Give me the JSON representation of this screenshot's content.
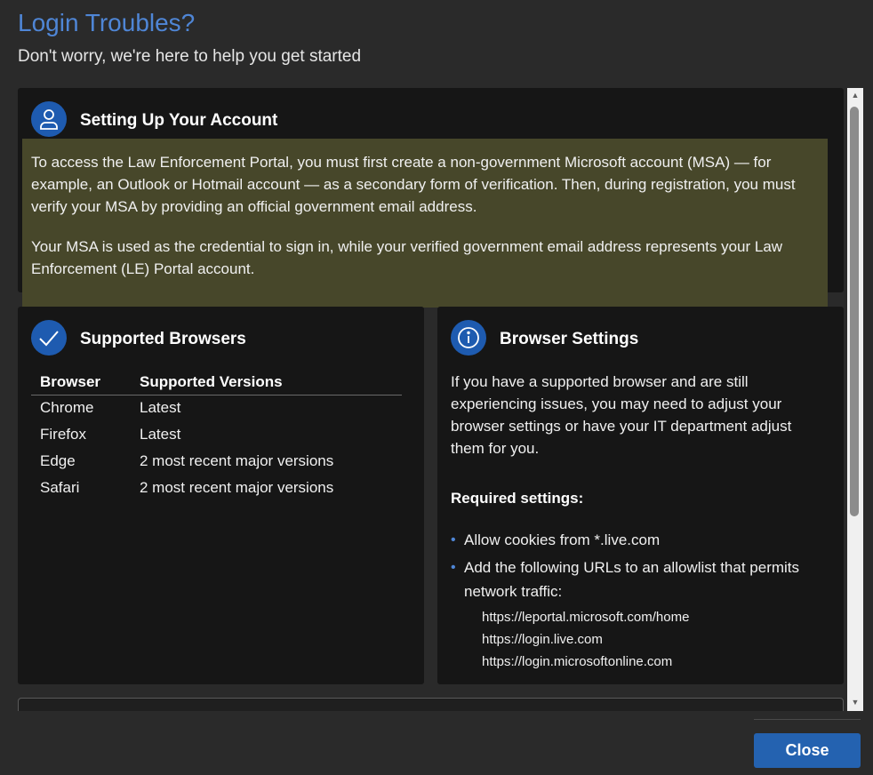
{
  "header": {
    "title": "Login Troubles?",
    "subtitle": "Don't worry, we're here to help you get started"
  },
  "account_card": {
    "icon": "person-icon",
    "title": "Setting Up Your Account",
    "paragraphs": [
      "To access the Law Enforcement Portal, you must first create a non-government Microsoft account (MSA) — for example, an Outlook or Hotmail account — as a secondary form of verification. Then, during registration, you must verify your MSA by providing an official government email address.",
      "Your MSA is used as the credential to sign in, while your verified government email address represents your Law Enforcement (LE) Portal account."
    ]
  },
  "browsers_card": {
    "icon": "checkmark-icon",
    "title": "Supported Browsers",
    "columns": [
      "Browser",
      "Supported Versions"
    ],
    "rows": [
      [
        "Chrome",
        "Latest"
      ],
      [
        "Firefox",
        "Latest"
      ],
      [
        "Edge",
        "2 most recent major versions"
      ],
      [
        "Safari",
        "2 most recent major versions"
      ]
    ]
  },
  "settings_card": {
    "icon": "info-icon",
    "title": "Browser Settings",
    "intro": "If you have a supported browser and are still experiencing issues, you may need to adjust your browser settings or have your IT department adjust them for you.",
    "required_heading": "Required settings:",
    "bullets": [
      "Allow cookies from *.live.com",
      "Add the following URLs to an allowlist that permits network traffic:"
    ],
    "urls": [
      "https://leportal.microsoft.com/home",
      "https://login.live.com",
      "https://login.microsoftonline.com"
    ]
  },
  "footer": {
    "close_label": "Close"
  },
  "colors": {
    "accent": "#4f86d6",
    "button": "#2462b0",
    "highlight": "#47472a"
  }
}
